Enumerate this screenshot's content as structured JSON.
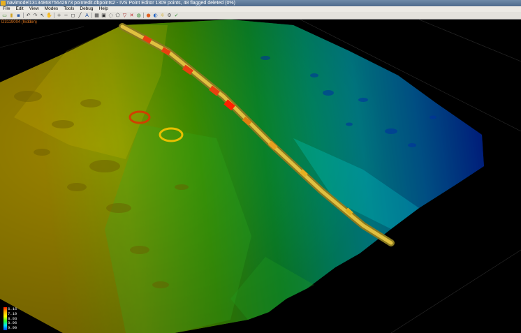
{
  "window": {
    "title": "navimodel1313486875642673 pointedit.dbpoints2 - IVS Point Editor 1309 points, 48 flagged deleted (0%)"
  },
  "menu": [
    "File",
    "Edit",
    "View",
    "Modes",
    "Tools",
    "Debug",
    "Help"
  ],
  "toolbar": [
    {
      "name": "new-icon",
      "glyph": "▭",
      "color": "#3c8a2a"
    },
    {
      "name": "open-icon",
      "glyph": "▮",
      "color": "#d0a020"
    },
    {
      "name": "save-icon",
      "glyph": "▪",
      "color": "#2a5aa8"
    },
    {
      "sep": true
    },
    {
      "name": "undo-icon",
      "glyph": "↶",
      "color": "#333333"
    },
    {
      "name": "redo-icon",
      "glyph": "↷",
      "color": "#333333"
    },
    {
      "name": "select-icon",
      "glyph": "↖",
      "color": "#333333"
    },
    {
      "name": "hand-icon",
      "glyph": "✋",
      "color": "#c08040"
    },
    {
      "sep": true
    },
    {
      "name": "zoom-in-icon",
      "glyph": "+",
      "color": "#333333"
    },
    {
      "name": "zoom-out-icon",
      "glyph": "−",
      "color": "#333333"
    },
    {
      "name": "fit-icon",
      "glyph": "◻",
      "color": "#333333"
    },
    {
      "name": "measure-icon",
      "glyph": "╱",
      "color": "#333333"
    },
    {
      "name": "text-icon",
      "glyph": "A",
      "color": "#2050a0"
    },
    {
      "sep": true
    },
    {
      "name": "grid-icon",
      "glyph": "▦",
      "color": "#333333"
    },
    {
      "name": "box-icon",
      "glyph": "▣",
      "color": "#333333"
    },
    {
      "name": "lasso-icon",
      "glyph": "◌",
      "color": "#333333"
    },
    {
      "name": "polygon-icon",
      "glyph": "⬠",
      "color": "#333333"
    },
    {
      "name": "filter-icon",
      "glyph": "▽",
      "color": "#a02020"
    },
    {
      "name": "delete-icon",
      "glyph": "✕",
      "color": "#c02020"
    },
    {
      "name": "restore-icon",
      "glyph": "◍",
      "color": "#2a8a2a"
    },
    {
      "sep": true
    },
    {
      "name": "color-icon",
      "glyph": "●",
      "color": "#e06020"
    },
    {
      "name": "palette-icon",
      "glyph": "◐",
      "color": "#2060c0"
    },
    {
      "name": "light-icon",
      "glyph": "☼",
      "color": "#d0a000"
    },
    {
      "name": "settings-icon",
      "glyph": "⚙",
      "color": "#555555"
    },
    {
      "name": "accept-icon",
      "glyph": "✓",
      "color": "#2a8a2a"
    }
  ],
  "viewport": {
    "hidden_label": "D3119004 (hidden)"
  },
  "legend": {
    "values": [
      "6.16",
      "7.10",
      "8.03",
      "8.96",
      "9.90"
    ]
  }
}
